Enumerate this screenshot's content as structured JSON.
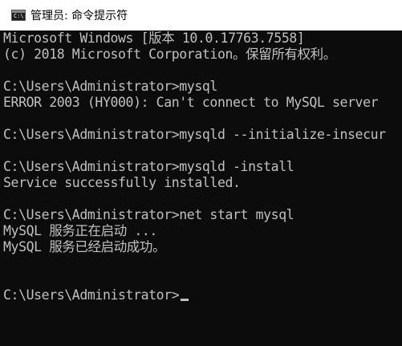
{
  "window": {
    "title": "管理员: 命令提示符",
    "icon": "cmd-icon"
  },
  "console": {
    "lines": [
      "Microsoft Windows [版本 10.0.17763.7558]",
      "(c) 2018 Microsoft Corporation。保留所有权利。",
      "",
      "C:\\Users\\Administrator>mysql",
      "ERROR 2003 (HY000): Can't connect to MySQL server",
      "",
      "C:\\Users\\Administrator>mysqld --initialize-insecur",
      "",
      "C:\\Users\\Administrator>mysqld -install",
      "Service successfully installed.",
      "",
      "C:\\Users\\Administrator>net start mysql",
      "MySQL 服务正在启动 ...",
      "MySQL 服务已经启动成功。",
      "",
      "",
      "C:\\Users\\Administrator>"
    ],
    "text_color": "#c0c0c0",
    "background": "#0c0c0c"
  }
}
